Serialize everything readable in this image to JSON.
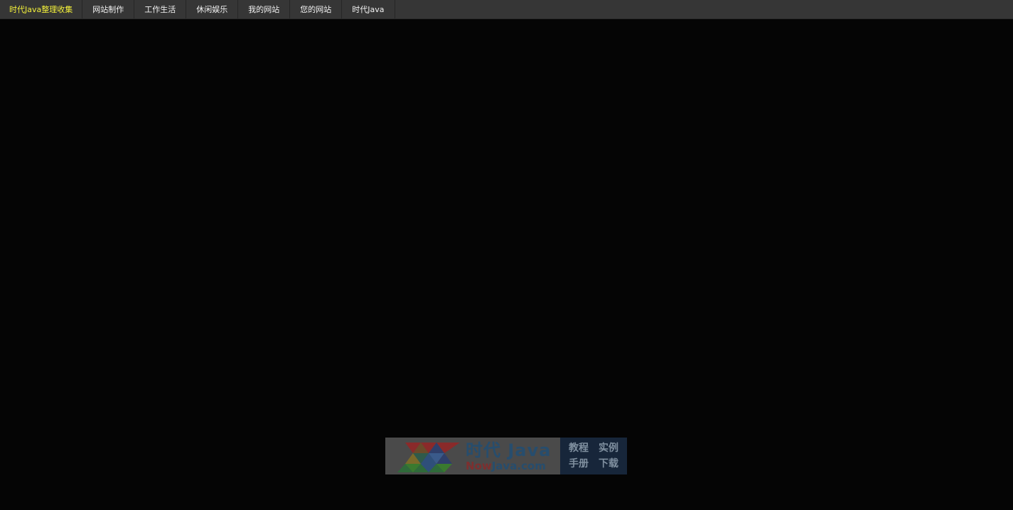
{
  "nav": {
    "brand": "时代Java整理收集",
    "items": [
      "网站制作",
      "工作生活",
      "休闲娱乐",
      "我的网站",
      "您的网站",
      "时代Java"
    ]
  },
  "banner": {
    "title_cn": "时代 Java",
    "domain_now": "Now",
    "domain_rest": "Java.com",
    "links": [
      "教程",
      "实例",
      "手册",
      "下载"
    ]
  },
  "colors": {
    "topbar": "#363636",
    "brand_text": "#f3f03a",
    "background": "#050505"
  }
}
